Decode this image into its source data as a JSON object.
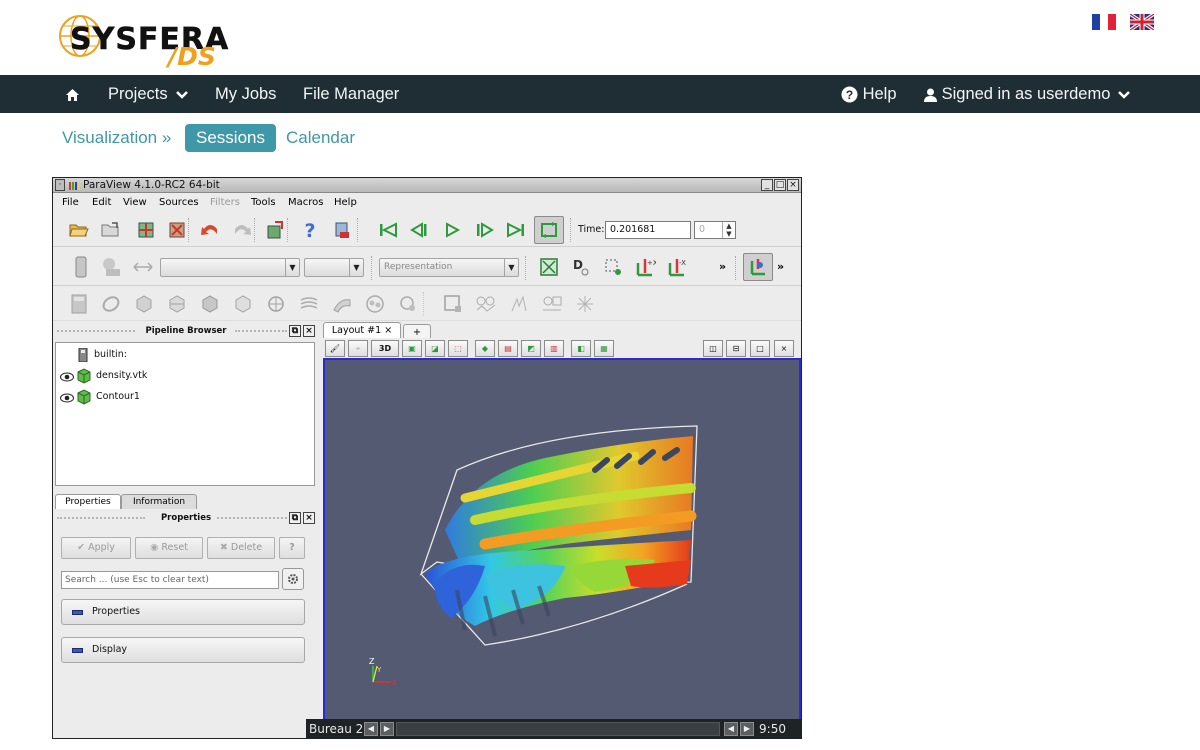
{
  "header": {
    "logo_text": "SYSFERA",
    "logo_sub": "/DS",
    "flags": [
      "french-flag",
      "uk-flag"
    ]
  },
  "navbar": {
    "home_icon": "home-icon",
    "projects": "Projects",
    "my_jobs": "My Jobs",
    "file_manager": "File Manager",
    "help": "Help",
    "signed_in": "Signed in as userdemo"
  },
  "subnav": {
    "visualization": "Visualization »",
    "sessions": "Sessions",
    "calendar": "Calendar"
  },
  "paraview": {
    "title": "ParaView 4.1.0-RC2 64-bit",
    "menu": [
      "File",
      "Edit",
      "View",
      "Sources",
      "Filters",
      "Tools",
      "Macros",
      "Help"
    ],
    "menu_disabled": "Filters",
    "time_label": "Time:",
    "time_value": "0.201681",
    "time_step": "0",
    "representation": "Representation",
    "more": "»",
    "pipeline_title": "Pipeline Browser",
    "pipeline_items": [
      "builtin:",
      "density.vtk",
      "Contour1"
    ],
    "tab_properties": "Properties",
    "tab_information": "Information",
    "properties_title": "Properties",
    "btn_apply": "Apply",
    "btn_reset": "Reset",
    "btn_delete": "Delete",
    "btn_help": "?",
    "search_placeholder": "Search ... (use Esc to clear text)",
    "group_properties": "Properties",
    "group_display": "Display",
    "layout_tab": "Layout #1",
    "layout_add": "+",
    "view_3d": "3D",
    "axes": {
      "z": "Z",
      "y": "Y",
      "x": "X"
    }
  },
  "taskbar": {
    "desktop": "Bureau 2",
    "clock": "9:50"
  },
  "colors": {
    "navbar_bg": "#1f2d35",
    "accent": "#3e98a8",
    "logo_orange": "#f0a01c",
    "viewport_bg": "#535a72",
    "viewport_border": "#2b2bd6"
  }
}
